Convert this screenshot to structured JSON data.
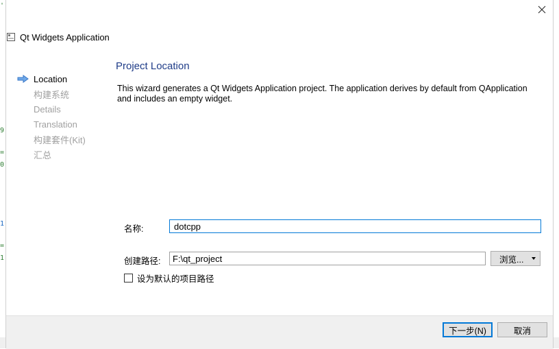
{
  "window": {
    "title": "Qt Widgets Application",
    "close_glyph": "✕"
  },
  "sidebar": {
    "items": [
      {
        "label": "Location",
        "active": true
      },
      {
        "label": "构建系统",
        "active": false
      },
      {
        "label": "Details",
        "active": false
      },
      {
        "label": "Translation",
        "active": false
      },
      {
        "label": "构建套件(Kit)",
        "active": false
      },
      {
        "label": "汇总",
        "active": false
      }
    ]
  },
  "page": {
    "title": "Project Location",
    "description": "This wizard generates a Qt Widgets Application project. The application derives by default from QApplication and includes an empty widget."
  },
  "form": {
    "name_label": "名称:",
    "name_value": "dotcpp",
    "path_label": "创建路径:",
    "path_value": "F:\\qt_project",
    "browse_label": "浏览...",
    "default_path_label": "设为默认的项目路径",
    "default_path_checked": false
  },
  "footer": {
    "next_label": "下一步(N)",
    "cancel_label": "取消"
  },
  "colors": {
    "accent": "#0078d7",
    "title_blue": "#1f3c88",
    "disabled_text": "#a0a0a0"
  },
  "icons": {
    "title": "window-icon",
    "active_step": "arrow-right-icon",
    "close": "close-icon"
  }
}
